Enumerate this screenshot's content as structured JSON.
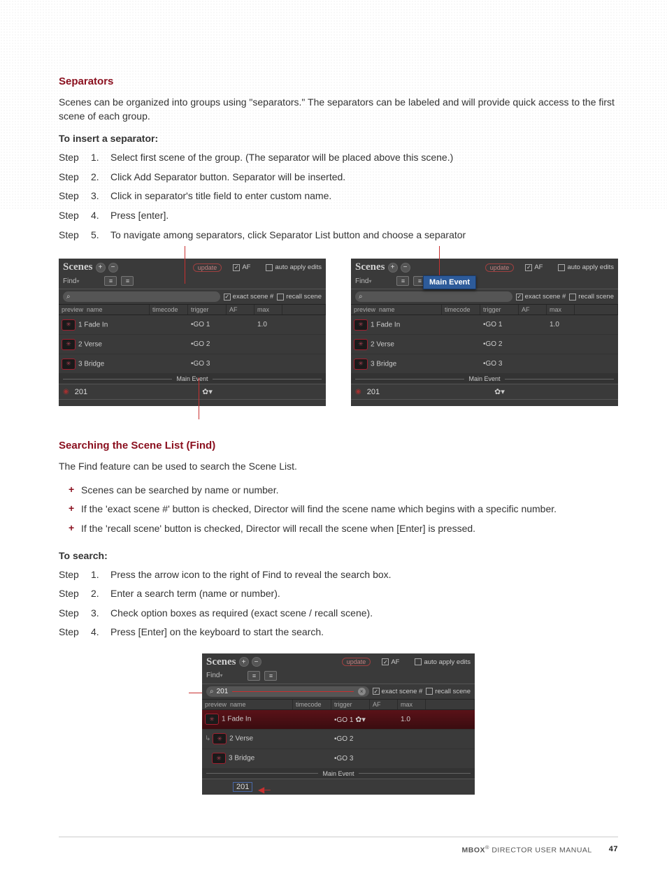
{
  "separators": {
    "heading": "Separators",
    "intro": "Scenes can be organized into groups using \"separators.\" The separators can be labeled and will provide quick access to the first scene of each group.",
    "to_insert": "To insert a separator:",
    "steps": [
      "Select first scene of the group. (The separator will be placed above this scene.)",
      "Click Add Separator button. Separator will be inserted.",
      "Click in separator's title field to enter custom name.",
      "Press [enter].",
      "To navigate among separators, click Separator List button and choose a separator"
    ]
  },
  "searching": {
    "heading": "Searching the Scene List (Find)",
    "intro": "The Find feature can be used to search the Scene List.",
    "bullets": [
      "Scenes can be searched by name or number.",
      "If the 'exact scene #' button is checked, Director will find the scene name which begins with a specific number.",
      "If the 'recall scene' button is checked, Director will recall the scene when [Enter] is pressed."
    ],
    "to_search": "To search:",
    "steps": [
      "Press the arrow icon to the right of Find to reveal the search box.",
      "Enter a search term (name or number).",
      "Check option boxes as required (exact scene / recall scene).",
      "Press [Enter] on the keyboard to start the search."
    ]
  },
  "step_label": "Step",
  "panel": {
    "title": "Scenes",
    "update": "update",
    "af": "AF",
    "auto_apply": "auto apply edits",
    "find": "Find",
    "exact": "exact scene #",
    "recall": "recall scene",
    "cols": {
      "preview": "preview",
      "name": "name",
      "timecode": "timecode",
      "trigger": "trigger",
      "af": "AF",
      "max": "max"
    },
    "rows": [
      {
        "name": "1 Fade In",
        "trigger": "•GO 1",
        "max": "1.0"
      },
      {
        "name": "2 Verse",
        "trigger": "•GO 2",
        "max": ""
      },
      {
        "name": "3 Bridge",
        "trigger": "•GO 3",
        "max": ""
      }
    ],
    "separator_name": "Main Event",
    "footer_num": "201",
    "search_value": "201",
    "dropdown_item": "Main Event"
  },
  "footer": {
    "manual": "MBOX",
    "manual2": " DIRECTOR USER MANUAL",
    "page": "47"
  }
}
